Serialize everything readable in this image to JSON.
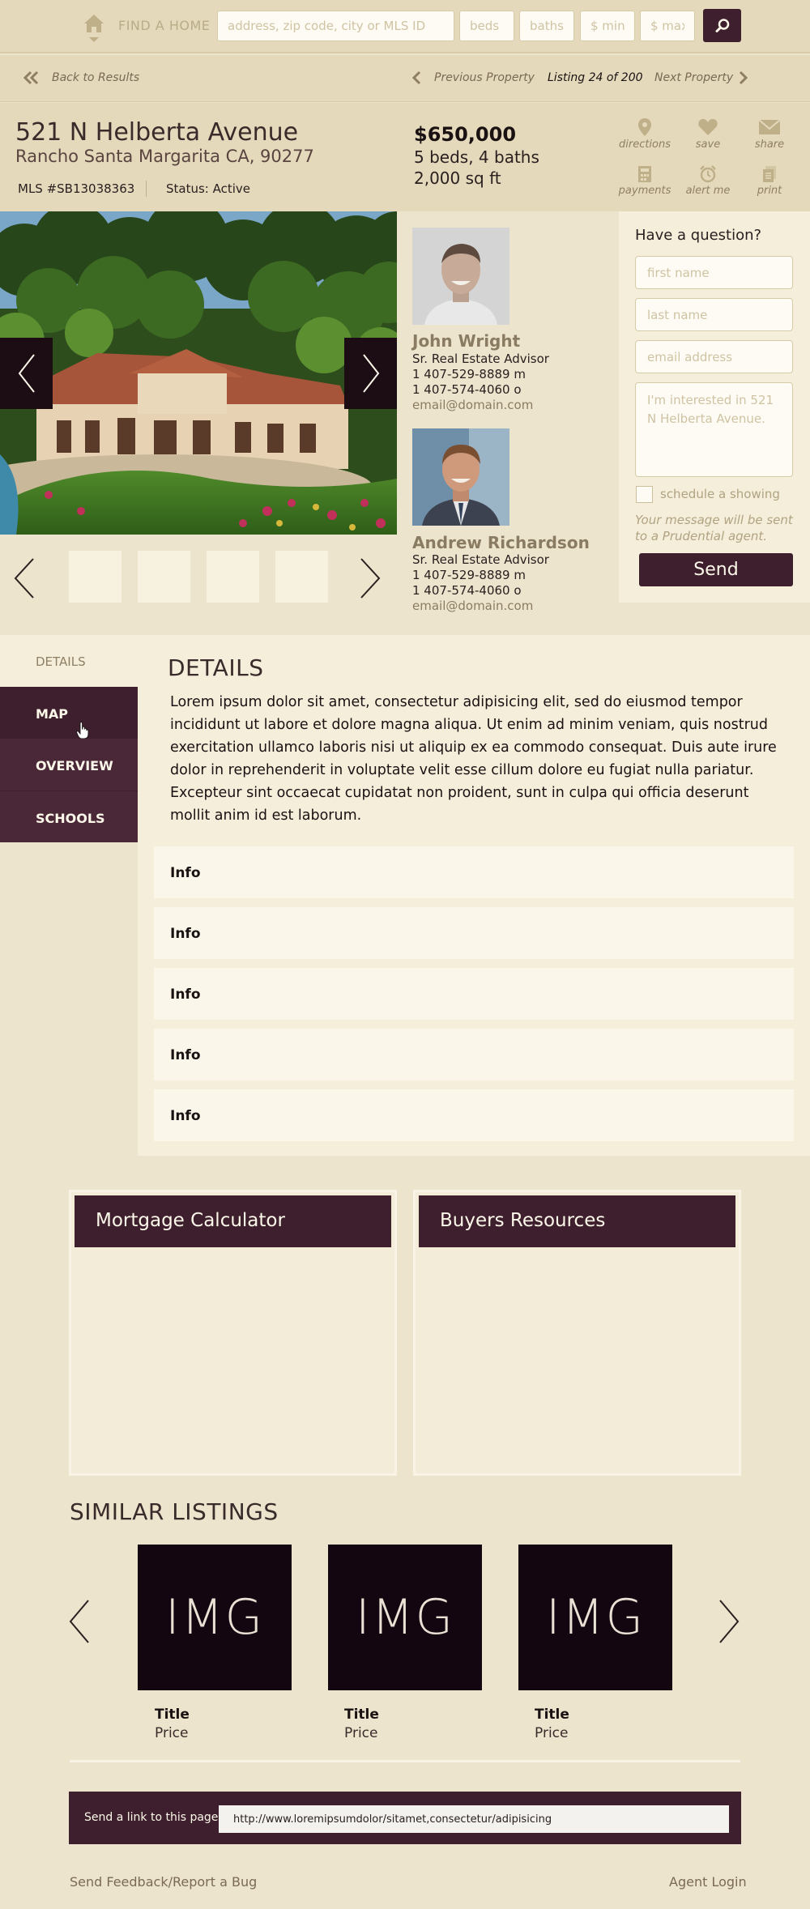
{
  "search": {
    "find_label": "FIND A HOME",
    "address_placeholder": "address, zip code, city or MLS ID",
    "beds_placeholder": "beds",
    "baths_placeholder": "baths",
    "min_placeholder": "$ min",
    "max_placeholder": "$ max"
  },
  "nav": {
    "back": "Back to Results",
    "previous": "Previous Property",
    "listing_counter": "Listing 24 of 200",
    "next": "Next Property"
  },
  "property": {
    "street": "521 N Helberta Avenue",
    "city": "Rancho Santa Margarita CA, 90277",
    "mls": "MLS #SB13038363",
    "status": "Status: Active",
    "price": "$650,000",
    "beds_baths": "5 beds, 4 baths",
    "sqft": "2,000 sq ft"
  },
  "actions": [
    {
      "label": "directions",
      "icon": "map-pin-icon"
    },
    {
      "label": "save",
      "icon": "heart-icon"
    },
    {
      "label": "share",
      "icon": "envelope-icon"
    },
    {
      "label": "payments",
      "icon": "calculator-icon"
    },
    {
      "label": "alert me",
      "icon": "alarm-clock-icon"
    },
    {
      "label": "print",
      "icon": "document-icon"
    }
  ],
  "agents": [
    {
      "name": "John Wright",
      "title": "Sr. Real Estate Advisor",
      "phone_m": "1 407-529-8889 m",
      "phone_o": "1 407-574-4060 o",
      "email": "email@domain.com"
    },
    {
      "name": "Andrew Richardson",
      "title": "Sr. Real Estate Advisor",
      "phone_m": "1 407-529-8889 m",
      "phone_o": "1 407-574-4060 o",
      "email": "email@domain.com"
    }
  ],
  "question": {
    "title": "Have a question?",
    "first_name_placeholder": "first name",
    "last_name_placeholder": "last name",
    "email_placeholder": "email address",
    "message_placeholder": "I'm interested in 521 N Helberta Avenue.",
    "schedule_label": "schedule a showing",
    "note": "Your message will be sent to a Prudential agent.",
    "send": "Send"
  },
  "tabs": {
    "details": "DETAILS",
    "map": "MAP",
    "overview": "OVERVIEW",
    "schools": "SCHOOLS"
  },
  "details": {
    "heading": "DETAILS",
    "body": "Lorem ipsum dolor sit amet, consectetur adipisicing elit, sed do eiusmod tempor incidid­unt ut labore et dolore magna aliqua. Ut enim ad minim veniam, quis nostrud exercita­tion ullamco laboris nisi ut aliquip ex ea commodo consequat. Duis aute irure dolor in reprehenderit in voluptate velit esse cillum dolore eu fugiat nulla pariatur. Excepteur sint occaecat cupidatat non proident, sunt in culpa qui officia deserunt mollit anim id est laborum.",
    "info_rows": [
      "Info",
      "Info",
      "Info",
      "Info",
      "Info"
    ]
  },
  "panels": {
    "mortgage": "Mortgage Calculator",
    "buyers": "Buyers Resources"
  },
  "similar": {
    "heading": "SIMILAR LISTINGS",
    "listings": [
      {
        "img": "IMG",
        "title": "Title",
        "price": "Price"
      },
      {
        "img": "IMG",
        "title": "Title",
        "price": "Price"
      },
      {
        "img": "IMG",
        "title": "Title",
        "price": "Price"
      }
    ]
  },
  "footer": {
    "send_link_label": "Send a link to this page",
    "link_value": "http://www.loremipsumdolor/sitamet,consectetur/adipisicing",
    "feedback": "Send Feedback/Report a Bug",
    "agent_login": "Agent Login"
  },
  "colors": {
    "accent": "#3e1f2d",
    "background": "#ede4cd",
    "header": "#e4d9bb",
    "panel": "#f5eedb"
  }
}
